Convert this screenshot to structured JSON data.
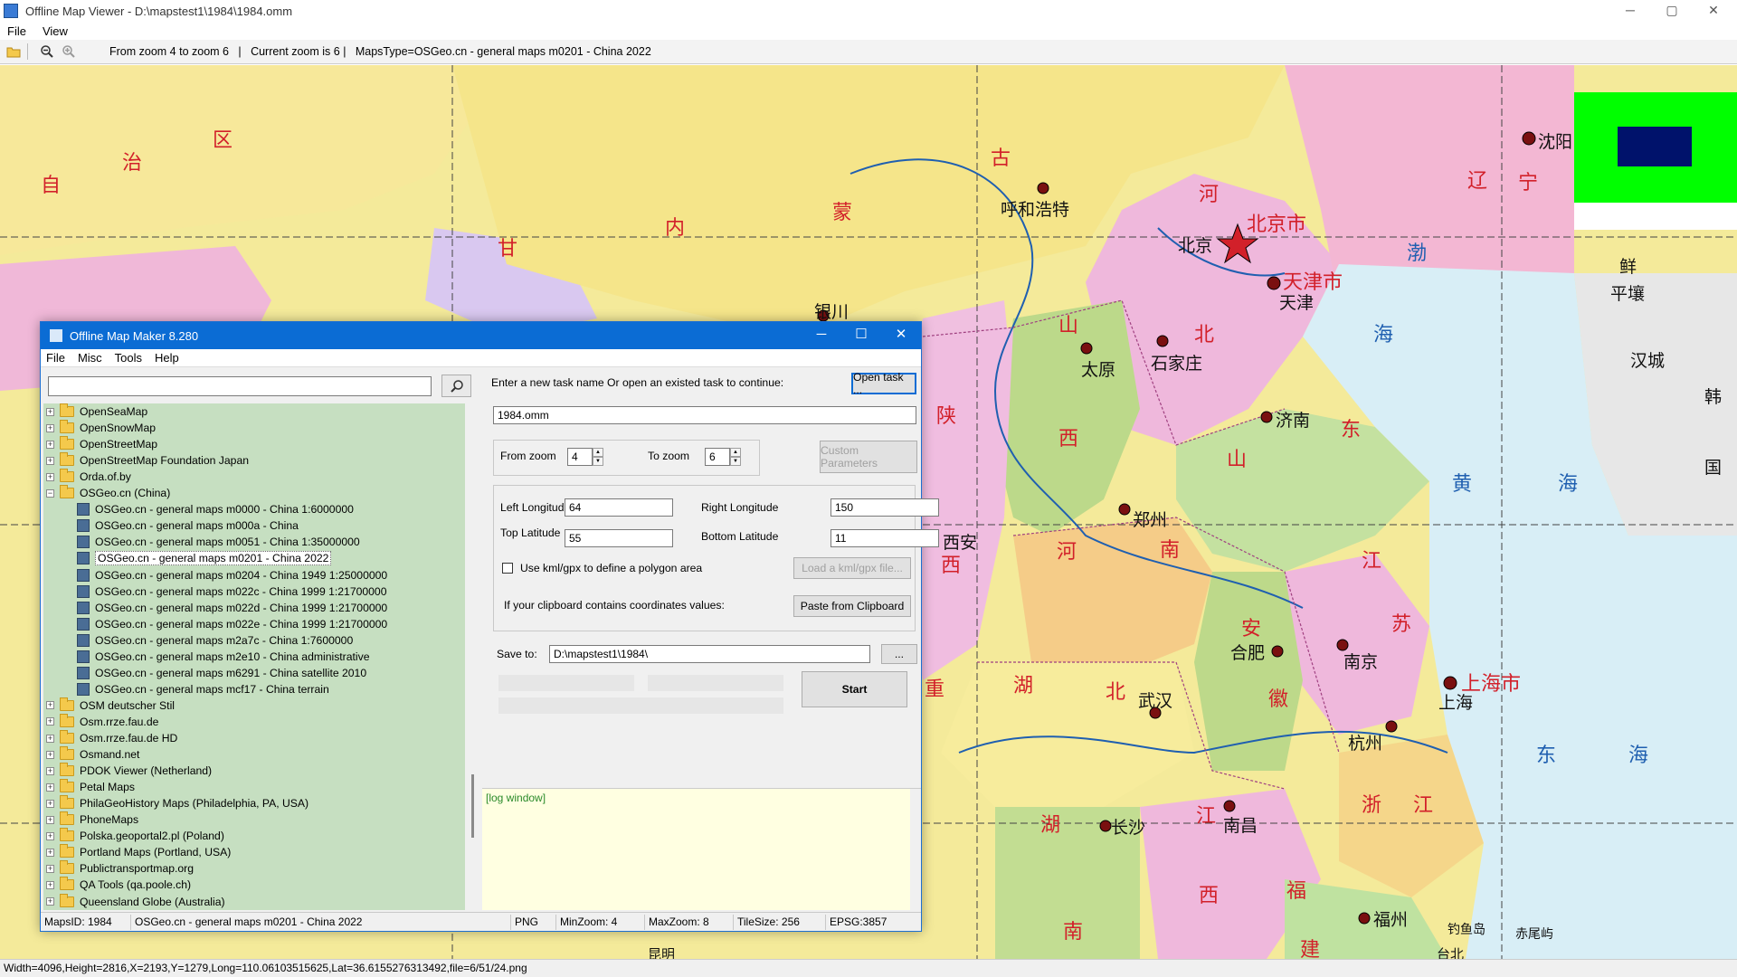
{
  "window": {
    "title": "Offline Map Viewer - D:\\mapstest1\\1984\\1984.omm",
    "controls": {
      "minimize": "─",
      "maximize": "▢",
      "close": "✕"
    }
  },
  "menu": [
    "File",
    "View"
  ],
  "toolbar": {
    "status": "From zoom 4 to zoom 6   |   Current zoom is 6 |   MapsType=OSGeo.cn - general maps m0201 - China 2022"
  },
  "map": {
    "labels_red": [
      "自",
      "治",
      "区",
      "古",
      "内",
      "蒙",
      "甘",
      "河",
      "北京市",
      "天津市",
      "辽",
      "宁",
      "山",
      "西",
      "北",
      "陕",
      "西",
      "东",
      "山",
      "河",
      "南",
      "安",
      "江",
      "苏",
      "湖",
      "北",
      "徽",
      "浙",
      "江",
      "江",
      "西",
      "湖",
      "南",
      "福",
      "建",
      "上海市",
      "重"
    ],
    "labels_city": [
      "呼和浩特",
      "北京",
      "天津",
      "沈阳",
      "太原",
      "石家庄",
      "济南",
      "郑州",
      "西安",
      "合肥",
      "南京",
      "武汉",
      "上海",
      "杭州",
      "南昌",
      "长沙",
      "福州",
      "银川",
      "平壤",
      "汉城",
      "鲜",
      "韩",
      "国",
      "钓鱼岛",
      "赤尾屿",
      "台北",
      "昆明"
    ],
    "labels_blue": [
      "渤",
      "海",
      "黄",
      "海",
      "东",
      "海"
    ]
  },
  "bottom_status": "Width=4096,Height=2816,X=2193,Y=1279,Long=110.06103515625,Lat=36.6155276313492,file=6/51/24.png",
  "dialog": {
    "title": "Offline Map Maker 8.280",
    "controls": {
      "minimize": "─",
      "maximize": "☐",
      "close": "✕"
    },
    "menu": [
      "File",
      "Misc",
      "Tools",
      "Help"
    ],
    "search": {
      "value": "",
      "placeholder": ""
    },
    "tree": [
      {
        "label": "OpenSeaMap",
        "kind": "folder",
        "level": 0,
        "expander": "+"
      },
      {
        "label": "OpenSnowMap",
        "kind": "folder",
        "level": 0,
        "expander": "+"
      },
      {
        "label": "OpenStreetMap",
        "kind": "folder",
        "level": 0,
        "expander": "+"
      },
      {
        "label": "OpenStreetMap Foundation Japan",
        "kind": "folder",
        "level": 0,
        "expander": "+"
      },
      {
        "label": "Orda.of.by",
        "kind": "folder",
        "level": 0,
        "expander": "+"
      },
      {
        "label": "OSGeo.cn (China)",
        "kind": "folder-open",
        "level": 0,
        "expander": "−"
      },
      {
        "label": "OSGeo.cn - general maps m0000 - China 1:6000000",
        "kind": "map",
        "level": 1
      },
      {
        "label": "OSGeo.cn - general maps m000a - China",
        "kind": "map",
        "level": 1
      },
      {
        "label": "OSGeo.cn - general maps m0051 - China 1:35000000",
        "kind": "map",
        "level": 1
      },
      {
        "label": "OSGeo.cn - general maps m0201 - China 2022",
        "kind": "map",
        "level": 1,
        "selected": true
      },
      {
        "label": "OSGeo.cn - general maps m0204 - China 1949 1:25000000",
        "kind": "map",
        "level": 1
      },
      {
        "label": "OSGeo.cn - general maps m022c - China 1999 1:21700000",
        "kind": "map",
        "level": 1
      },
      {
        "label": "OSGeo.cn - general maps m022d - China 1999 1:21700000",
        "kind": "map",
        "level": 1
      },
      {
        "label": "OSGeo.cn - general maps m022e - China 1999 1:21700000",
        "kind": "map",
        "level": 1
      },
      {
        "label": "OSGeo.cn - general maps m2a7c - China 1:7600000",
        "kind": "map",
        "level": 1
      },
      {
        "label": "OSGeo.cn - general maps m2e10 - China administrative",
        "kind": "map",
        "level": 1
      },
      {
        "label": "OSGeo.cn - general maps m6291 - China satellite 2010",
        "kind": "map",
        "level": 1
      },
      {
        "label": "OSGeo.cn - general maps mcf17 - China terrain",
        "kind": "map",
        "level": 1
      },
      {
        "label": "OSM deutscher Stil",
        "kind": "folder",
        "level": 0,
        "expander": "+"
      },
      {
        "label": "Osm.rrze.fau.de",
        "kind": "folder",
        "level": 0,
        "expander": "+"
      },
      {
        "label": "Osm.rrze.fau.de HD",
        "kind": "folder",
        "level": 0,
        "expander": "+"
      },
      {
        "label": "Osmand.net",
        "kind": "folder",
        "level": 0,
        "expander": "+"
      },
      {
        "label": "PDOK Viewer (Netherland)",
        "kind": "folder",
        "level": 0,
        "expander": "+"
      },
      {
        "label": "Petal Maps",
        "kind": "folder",
        "level": 0,
        "expander": "+"
      },
      {
        "label": "PhilaGeoHistory Maps (Philadelphia, PA, USA)",
        "kind": "folder",
        "level": 0,
        "expander": "+"
      },
      {
        "label": "PhoneMaps",
        "kind": "folder",
        "level": 0,
        "expander": "+"
      },
      {
        "label": "Polska.geoportal2.pl (Poland)",
        "kind": "folder",
        "level": 0,
        "expander": "+"
      },
      {
        "label": "Portland Maps (Portland, USA)",
        "kind": "folder",
        "level": 0,
        "expander": "+"
      },
      {
        "label": "Publictransportmap.org",
        "kind": "folder",
        "level": 0,
        "expander": "+"
      },
      {
        "label": "QA Tools (qa.poole.ch)",
        "kind": "folder",
        "level": 0,
        "expander": "+"
      },
      {
        "label": "Queensland Globe (Australia)",
        "kind": "folder",
        "level": 0,
        "expander": "+"
      }
    ],
    "task_prompt": "Enter a new task name Or open an existed task to continue:",
    "open_task_label": "Open task ...",
    "task_name": "1984.omm",
    "from_zoom_label": "From zoom",
    "from_zoom": "4",
    "to_zoom_label": "To zoom",
    "to_zoom": "6",
    "custom_params_label": "Custom Parameters",
    "left_longitude_label": "Left Longitude",
    "left_longitude": "64",
    "right_longitude_label": "Right Longitude",
    "right_longitude": "150",
    "top_latitude_label": "Top Latitude",
    "top_latitude": "55",
    "bottom_latitude_label": "Bottom Latitude",
    "bottom_latitude": "11",
    "kml_checkbox_label": "Use kml/gpx to define a polygon area",
    "kml_checked": false,
    "load_kml_label": "Load a kml/gpx file...",
    "clipboard_prompt": "If your clipboard contains coordinates values:",
    "paste_label": "Paste from Clipboard",
    "save_to_label": "Save to:",
    "save_to": "D:\\mapstest1\\1984\\",
    "browse_label": "...",
    "start_label": "Start",
    "log_text": "[log window]",
    "status": [
      "MapsID: 1984",
      "OSGeo.cn - general maps m0201 - China 2022",
      "PNG",
      "MinZoom: 4",
      "MaxZoom: 8",
      "TileSize: 256",
      "EPSG:3857"
    ]
  },
  "colors": {
    "dialog_title": "#0b6cd4",
    "tree_bg": "#c6dfc1",
    "log_bg": "#ffffe1",
    "accent_red": "#d2202a"
  }
}
